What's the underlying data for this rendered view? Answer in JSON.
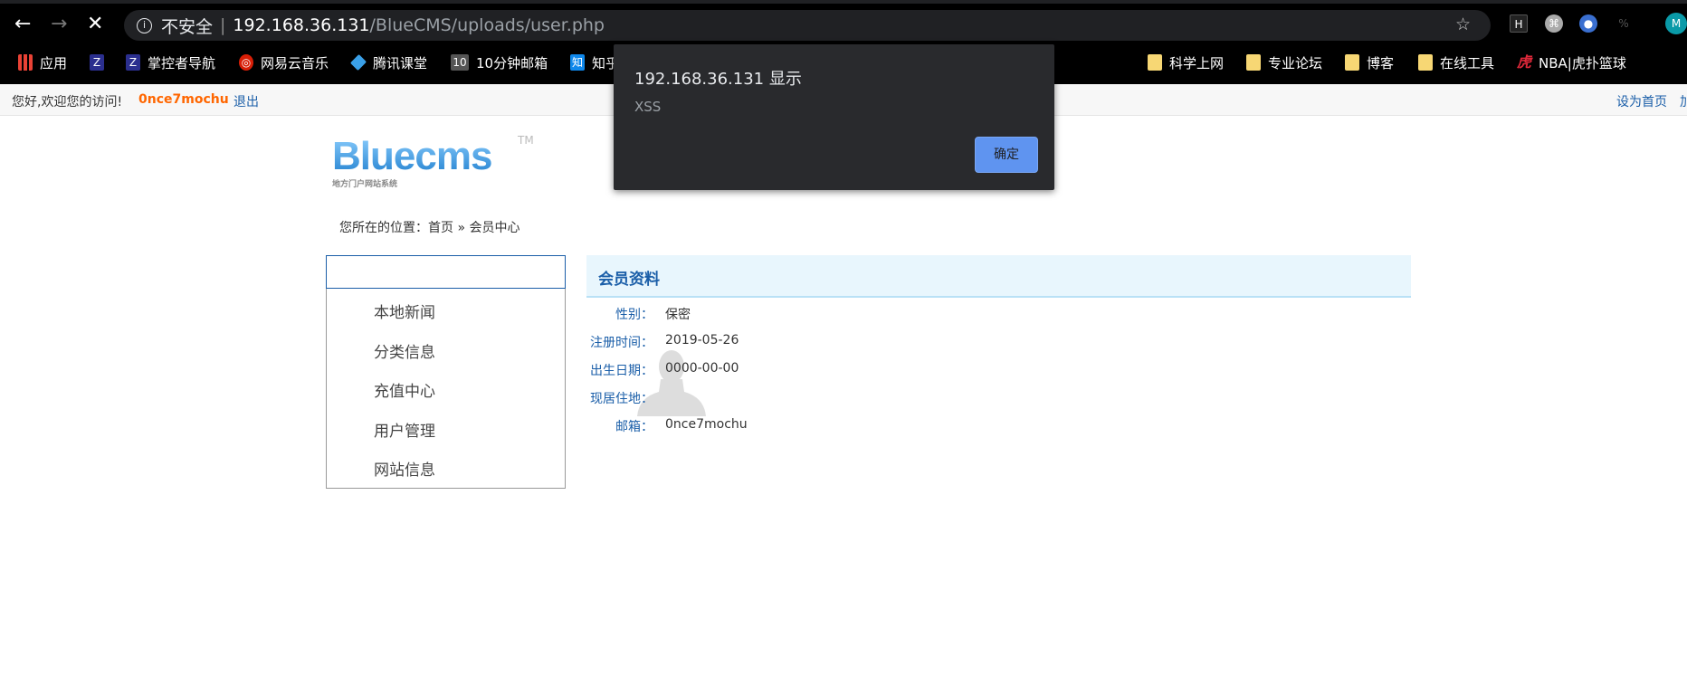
{
  "browser": {
    "security_label": "不安全",
    "url_host": "192.168.36.131",
    "url_path": "/BlueCMS/uploads/user.php",
    "profile_initial": "M",
    "bookmarks": [
      {
        "label": "应用",
        "icon": "apps-grid-icon"
      },
      {
        "label": "",
        "icon": "shield-icon"
      },
      {
        "label": "掌控者导航",
        "icon": "shield-icon"
      },
      {
        "label": "网易云音乐",
        "icon": "netease-music-icon"
      },
      {
        "label": "腾讯课堂",
        "icon": "tencent-classroom-icon"
      },
      {
        "label": "10分钟邮箱",
        "icon": "ten-icon"
      },
      {
        "label": "知乎",
        "icon": "zhihu-icon"
      },
      {
        "label": "科学上网",
        "icon": "folder-icon"
      },
      {
        "label": "专业论坛",
        "icon": "folder-icon"
      },
      {
        "label": "博客",
        "icon": "folder-icon"
      },
      {
        "label": "在线工具",
        "icon": "folder-icon"
      },
      {
        "label": "NBA|虎扑篮球",
        "icon": "hupu-icon"
      }
    ]
  },
  "topbar": {
    "greeting": "您好,欢迎您的访问!",
    "username": "0nce7mochu",
    "logout": "退出",
    "set_home": "设为首页",
    "add_fav": "加"
  },
  "logo": {
    "text": "Bluecms",
    "tm": "TM",
    "subtitle": "地方门户网站系统"
  },
  "breadcrumb": "您所在的位置：首页 » 会员中心",
  "sidebar": {
    "items": [
      "本地新闻",
      "分类信息",
      "充值中心",
      "用户管理",
      "网站信息"
    ]
  },
  "profile": {
    "title": "会员资料",
    "fields": [
      {
        "label": "性别：",
        "value": "保密"
      },
      {
        "label": "注册时间：",
        "value": "2019-05-26"
      },
      {
        "label": "出生日期：",
        "value": "0000-00-00"
      },
      {
        "label": "现居住地：",
        "value": ""
      },
      {
        "label": "邮箱：",
        "value": "0nce7mochu"
      }
    ]
  },
  "dialog": {
    "title": "192.168.36.131 显示",
    "message": "XSS",
    "ok": "确定"
  }
}
